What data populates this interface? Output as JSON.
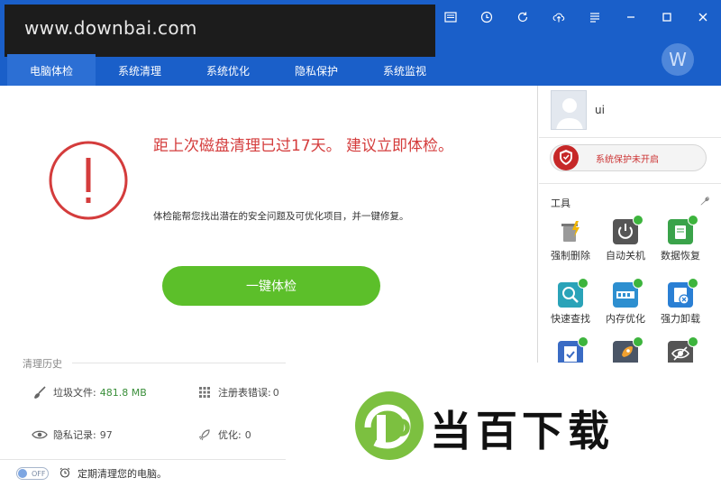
{
  "watermark": {
    "text": "www.downbai.com"
  },
  "nav": {
    "items": [
      {
        "label": "电脑体检",
        "active": true
      },
      {
        "label": "系统清理"
      },
      {
        "label": "系统优化"
      },
      {
        "label": "隐私保护"
      },
      {
        "label": "系统监视"
      }
    ]
  },
  "avatar_letter": "W",
  "main": {
    "headline": "距上次磁盘清理已过17天。 建议立即体检。",
    "description": "体检能帮您找出潜在的安全问题及可优化项目，并一键修复。",
    "button_label": "一键体检"
  },
  "history": {
    "title": "清理历史",
    "junk_label": "垃圾文件:",
    "junk_value": "481.8 MB",
    "reg_label": "注册表错误:",
    "reg_value": "0",
    "privacy_label": "隐私记录:",
    "privacy_value": "97",
    "opt_label": "优化:",
    "opt_value": "0"
  },
  "bottom": {
    "toggle_text": "OFF",
    "schedule_text": "定期清理您的电脑。"
  },
  "side": {
    "username": "ui",
    "protect_text": "系统保护未开启",
    "tools_title": "工具",
    "tools": [
      {
        "label": "强制删除",
        "icon": "trash-icon",
        "color": "#8a8a8a"
      },
      {
        "label": "自动关机",
        "icon": "power-icon",
        "color": "#555555"
      },
      {
        "label": "数据恢复",
        "icon": "data-recovery-icon",
        "color": "#3aa34a"
      },
      {
        "label": "快速查找",
        "icon": "search-icon",
        "color": "#2aa3b8"
      },
      {
        "label": "内存优化",
        "icon": "memory-icon",
        "color": "#2d8fd0"
      },
      {
        "label": "强力卸载",
        "icon": "uninstall-icon",
        "color": "#2a7fd4"
      },
      {
        "label": "",
        "icon": "checklist-icon",
        "color": "#3a6bc4"
      },
      {
        "label": "",
        "icon": "rocket-icon",
        "color": "#4a5566"
      },
      {
        "label": "",
        "icon": "hidden-eye-icon",
        "color": "#555555"
      }
    ]
  },
  "logo": {
    "text": "当百下载",
    "letter": "D"
  },
  "colors": {
    "header": "#1a5fc9",
    "accent_green": "#5cbf2a",
    "warn_red": "#d43c3c"
  }
}
